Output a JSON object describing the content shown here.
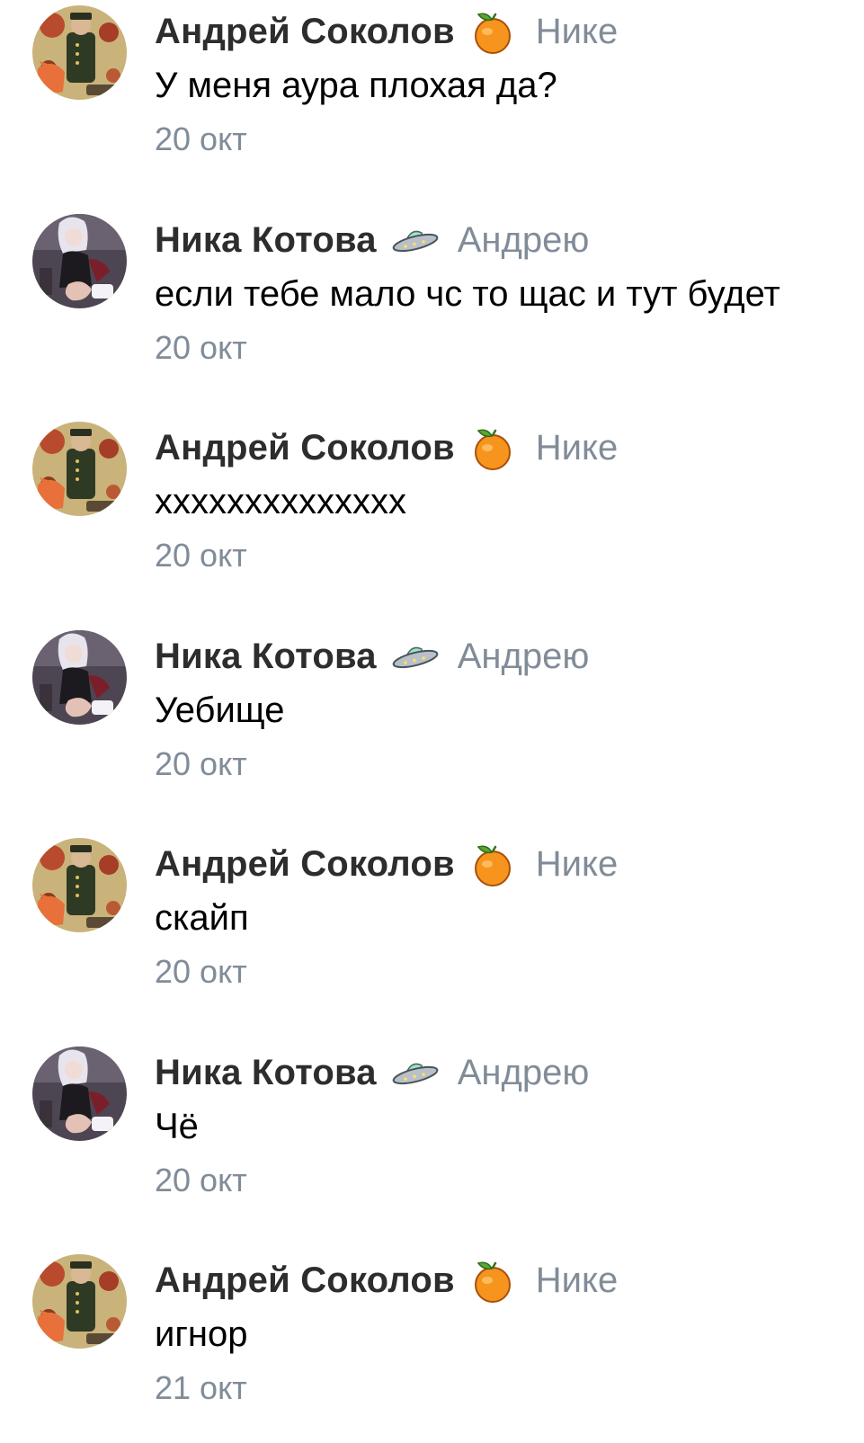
{
  "colors": {
    "author": "#2c2d2e",
    "meta": "#818c99",
    "text": "#000000",
    "background": "#ffffff"
  },
  "comments": [
    {
      "author": "Андрей Соколов",
      "emoji": "tangerine-icon",
      "reply_to": "Нике",
      "text": "У меня аура плохая да?",
      "date": "20 окт"
    },
    {
      "author": "Ника Котова",
      "emoji": "ufo-icon",
      "reply_to": "Андрею",
      "text": "если  тебе мало чс то щас и тут будет",
      "date": "20 окт"
    },
    {
      "author": "Андрей Соколов",
      "emoji": "tangerine-icon",
      "reply_to": "Нике",
      "text": "хххххххххххххх",
      "date": "20 окт"
    },
    {
      "author": "Ника Котова",
      "emoji": "ufo-icon",
      "reply_to": "Андрею",
      "text": "Уебище",
      "date": "20 окт"
    },
    {
      "author": "Андрей Соколов",
      "emoji": "tangerine-icon",
      "reply_to": "Нике",
      "text": "скайп",
      "date": "20 окт"
    },
    {
      "author": "Ника Котова",
      "emoji": "ufo-icon",
      "reply_to": "Андрею",
      "text": "Чё",
      "date": "20 окт"
    },
    {
      "author": "Андрей Соколов",
      "emoji": "tangerine-icon",
      "reply_to": "Нике",
      "text": "игнор",
      "date": "21 окт"
    }
  ]
}
